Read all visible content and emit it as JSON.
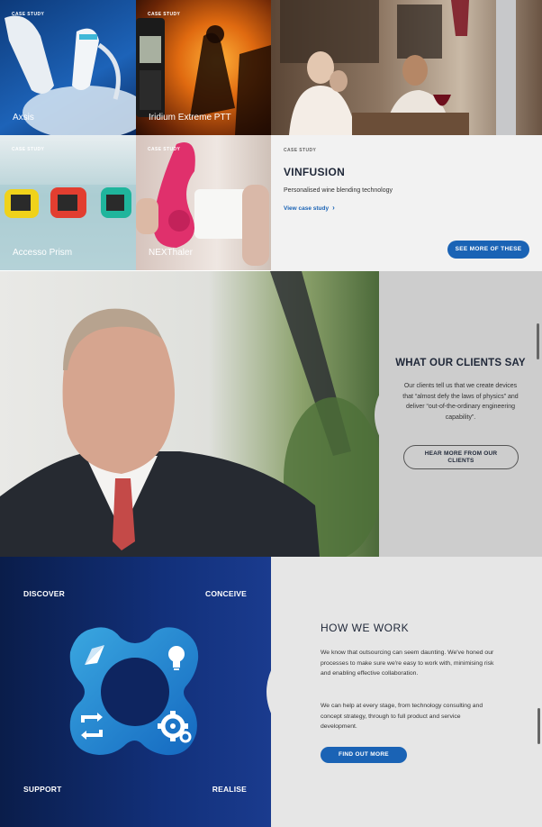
{
  "tiles": [
    {
      "tag": "CASE STUDY",
      "name": "Axsis"
    },
    {
      "tag": "CASE STUDY",
      "name": "Iridium Extreme PTT"
    },
    {
      "tag": "CASE STUDY",
      "name": "Accesso Prism"
    },
    {
      "tag": "CASE STUDY",
      "name": "NEXThaler"
    }
  ],
  "vinfusion": {
    "tag": "CASE STUDY",
    "title": "VINFUSION",
    "description": "Personalised wine blending technology",
    "link": "View case study",
    "button": "SEE MORE OF THESE"
  },
  "clients": {
    "title": "WHAT OUR CLIENTS SAY",
    "text": "Our clients tell us that we create devices that “almost defy the laws of physics” and deliver “out-of-the-ordinary engineering capability”.",
    "button": "HEAR MORE FROM OUR CLIENTS"
  },
  "work": {
    "stages": {
      "discover": "DISCOVER",
      "conceive": "CONCEIVE",
      "support": "SUPPORT",
      "realise": "REALISE"
    },
    "title": "HOW WE WORK",
    "para1": "We know that outsourcing can seem daunting. We've honed our processes to make sure we're easy to work with, minimising risk and enabling effective collaboration.",
    "para2": "We can help at every stage, from technology consulting and concept strategy, through to full product and service development.",
    "button": "FIND OUT MORE"
  },
  "icons": [
    "compass-icon",
    "lightbulb-icon",
    "refresh-icon",
    "gear-icon",
    "chevron-right-icon"
  ],
  "colors": {
    "accent": "#1a63b5",
    "navy": "#1f2738",
    "panel_grey": "#cdcdcd"
  }
}
